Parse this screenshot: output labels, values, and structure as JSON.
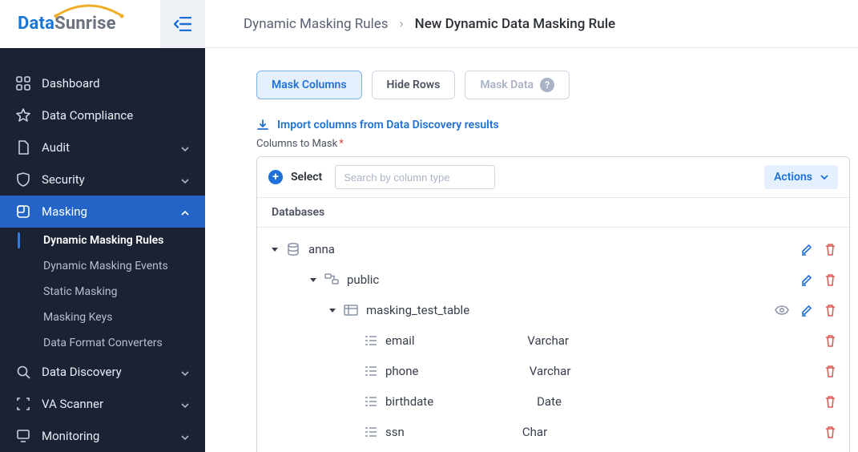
{
  "brand": {
    "part1": "Data",
    "part2": "Sunrise"
  },
  "breadcrumb": {
    "parent": "Dynamic Masking Rules",
    "sep": "›",
    "current": "New Dynamic Data Masking Rule"
  },
  "sidebar": {
    "items": [
      {
        "label": "Dashboard"
      },
      {
        "label": "Data Compliance"
      },
      {
        "label": "Audit"
      },
      {
        "label": "Security"
      },
      {
        "label": "Masking"
      },
      {
        "label": "Data Discovery"
      },
      {
        "label": "VA Scanner"
      },
      {
        "label": "Monitoring"
      }
    ],
    "masking_sub": [
      {
        "label": "Dynamic Masking Rules"
      },
      {
        "label": "Dynamic Masking Events"
      },
      {
        "label": "Static Masking"
      },
      {
        "label": "Masking Keys"
      },
      {
        "label": "Data Format Converters"
      }
    ]
  },
  "tabs": {
    "mask_columns": "Mask Columns",
    "hide_rows": "Hide Rows",
    "mask_data": "Mask Data"
  },
  "import_line": "Import columns from Data Discovery results",
  "columns_label": "Columns to Mask",
  "required_mark": "*",
  "toolbar": {
    "select": "Select",
    "search_placeholder": "Search by column type",
    "actions": "Actions"
  },
  "panel_header": "Databases",
  "tree": {
    "db": {
      "name": "anna"
    },
    "schema": {
      "name": "public"
    },
    "table": {
      "name": "masking_test_table"
    },
    "cols": [
      {
        "name": "email",
        "type": "Varchar"
      },
      {
        "name": "phone",
        "type": "Varchar"
      },
      {
        "name": "birthdate",
        "type": "Date"
      },
      {
        "name": "ssn",
        "type": "Char"
      }
    ]
  }
}
